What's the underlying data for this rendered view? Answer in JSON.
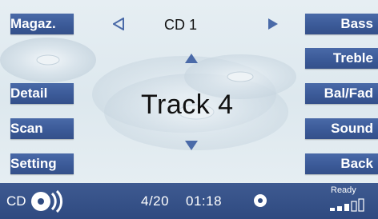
{
  "left_buttons": [
    {
      "label": "Magaz."
    },
    {
      "label": "Detail"
    },
    {
      "label": "Scan"
    },
    {
      "label": "Setting"
    }
  ],
  "right_buttons": [
    {
      "label": "Bass"
    },
    {
      "label": "Treble"
    },
    {
      "label": "Bal/Fad"
    },
    {
      "label": "Sound"
    },
    {
      "label": "Back"
    }
  ],
  "header": {
    "disc_label": "CD 1",
    "prev_icon": "triangle-left-icon",
    "next_icon": "triangle-right-icon"
  },
  "main": {
    "track_label": "Track 4",
    "up_icon": "triangle-up-icon",
    "down_icon": "triangle-down-icon"
  },
  "status": {
    "source": "CD",
    "track_progress": "4/20",
    "time": "01:18",
    "ready": "Ready",
    "signal_bars_active": 3,
    "signal_bars_total": 5
  },
  "colors": {
    "button_blue": "#3b5a98",
    "status_bar": "#2f4a80",
    "background": "#e2ecf1"
  }
}
